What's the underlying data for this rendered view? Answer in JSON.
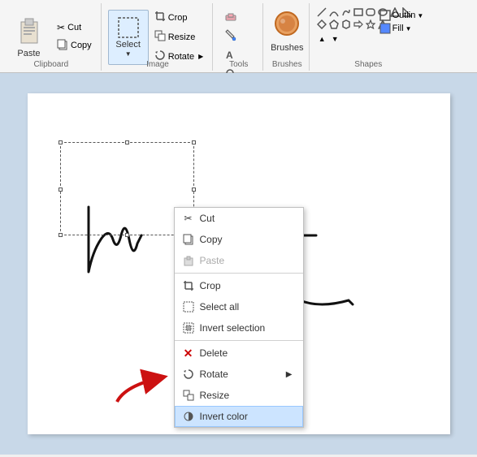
{
  "toolbar": {
    "groups": {
      "clipboard": {
        "label": "Clipboard",
        "paste_label": "Paste",
        "cut_label": "Cut",
        "copy_label": "Copy"
      },
      "image": {
        "label": "Image",
        "crop_label": "Crop",
        "resize_label": "Resize",
        "rotate_label": "Rotate",
        "select_label": "Select"
      },
      "tools": {
        "label": "Tools"
      },
      "brushes": {
        "label": "Brushes"
      },
      "shapes": {
        "label": "Shapes"
      }
    }
  },
  "context_menu": {
    "items": [
      {
        "id": "cut",
        "label": "Cut",
        "icon": "scissors",
        "enabled": true,
        "has_arrow": false
      },
      {
        "id": "copy",
        "label": "Copy",
        "icon": "copy",
        "enabled": true,
        "has_arrow": false
      },
      {
        "id": "paste",
        "label": "Paste",
        "icon": "paste",
        "enabled": false,
        "has_arrow": false
      },
      {
        "id": "crop",
        "label": "Crop",
        "icon": "crop",
        "enabled": true,
        "has_arrow": false
      },
      {
        "id": "select-all",
        "label": "Select all",
        "icon": "select",
        "enabled": true,
        "has_arrow": false
      },
      {
        "id": "invert-selection",
        "label": "Invert selection",
        "icon": "invert-sel",
        "enabled": true,
        "has_arrow": false
      },
      {
        "id": "delete",
        "label": "Delete",
        "icon": "delete",
        "enabled": true,
        "has_arrow": false
      },
      {
        "id": "rotate",
        "label": "Rotate",
        "icon": "rotate",
        "enabled": true,
        "has_arrow": true
      },
      {
        "id": "resize",
        "label": "Resize",
        "icon": "resize",
        "enabled": true,
        "has_arrow": false
      },
      {
        "id": "invert-color",
        "label": "Invert color",
        "icon": "invert-color",
        "enabled": true,
        "has_arrow": false,
        "highlighted": true
      }
    ]
  },
  "colors": {
    "highlight_bg": "#cce4ff",
    "highlight_border": "#99c8ff",
    "canvas_bg": "#c8d8e8",
    "paper_bg": "#ffffff",
    "arrow_color": "#cc1111"
  }
}
